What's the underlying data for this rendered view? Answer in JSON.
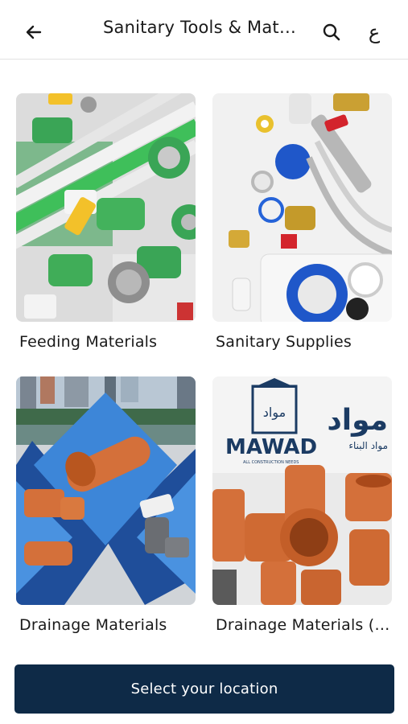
{
  "header": {
    "title": "Sanitary Tools & Mat…",
    "language_toggle": "ع",
    "icons": {
      "back": "arrow-left-icon",
      "search": "search-icon"
    }
  },
  "categories": [
    {
      "label": "Feeding Materials"
    },
    {
      "label": "Sanitary Supplies"
    },
    {
      "label": "Drainage Materials"
    },
    {
      "label": "Drainage Materials (…"
    }
  ],
  "images": {
    "mawad_brand": "MAWAD",
    "mawad_tagline": "ALL CONSTRUCTION NEEDS",
    "mawad_arabic_top": "مواد",
    "mawad_arabic_side": "مواد البناء",
    "mawad_arabic_logo": "مواد"
  },
  "footer": {
    "cta_label": "Select your location"
  },
  "colors": {
    "primary": "#0e2a47",
    "divider": "#e2e2e2",
    "pipe_orange": "#d4703a",
    "pipe_green": "#3aa556"
  }
}
